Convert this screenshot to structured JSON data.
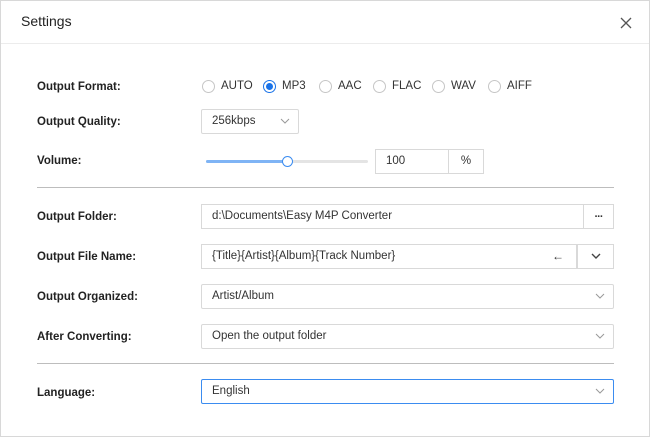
{
  "window": {
    "title": "Settings"
  },
  "output_format": {
    "label": "Output Format:",
    "options": [
      "AUTO",
      "MP3",
      "AAC",
      "FLAC",
      "WAV",
      "AIFF"
    ],
    "selected": "MP3"
  },
  "output_quality": {
    "label": "Output Quality:",
    "value": "256kbps"
  },
  "volume": {
    "label": "Volume:",
    "value": "100",
    "unit": "%",
    "level": 0.5
  },
  "output_folder": {
    "label": "Output Folder:",
    "value": "d:\\Documents\\Easy M4P Converter",
    "browse_label": "···"
  },
  "output_file_name": {
    "label": "Output File Name:",
    "value": "{Title}{Artist}{Album}{Track Number}",
    "back_label": "←"
  },
  "output_organized": {
    "label": "Output Organized:",
    "value": "Artist/Album"
  },
  "after_converting": {
    "label": "After Converting:",
    "value": "Open the output folder"
  },
  "language": {
    "label": "Language:",
    "value": "English"
  },
  "colors": {
    "accent": "#1a73e8",
    "slider_fill": "#7fb4f5"
  }
}
